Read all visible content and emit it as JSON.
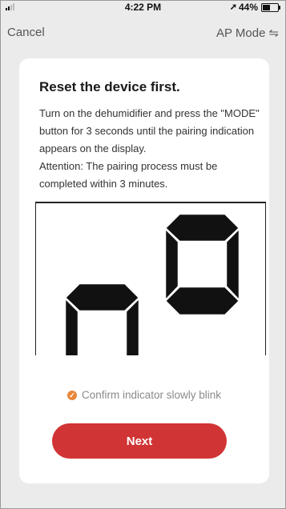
{
  "status_bar": {
    "time": "4:22 PM",
    "location_icon": "location-arrow-icon",
    "battery_percent": "44%",
    "battery_level": 0.44
  },
  "nav": {
    "cancel_label": "Cancel",
    "ap_mode_label": "AP Mode",
    "ap_mode_icon": "⇋"
  },
  "card": {
    "title": "Reset the device first.",
    "description_line1": "Turn on the dehumidifier and press the \"MODE\" button for 3 seconds until the pairing indication appears on the display.",
    "description_line2": "Attention: The pairing process must be completed within 3 minutes.",
    "illustration_icon": "segment-display-icon",
    "confirm_label": "Confirm indicator slowly blink",
    "confirm_checked": true,
    "next_label": "Next"
  },
  "colors": {
    "accent": "#d13434",
    "check": "#e8873a",
    "background": "#ebebeb"
  }
}
